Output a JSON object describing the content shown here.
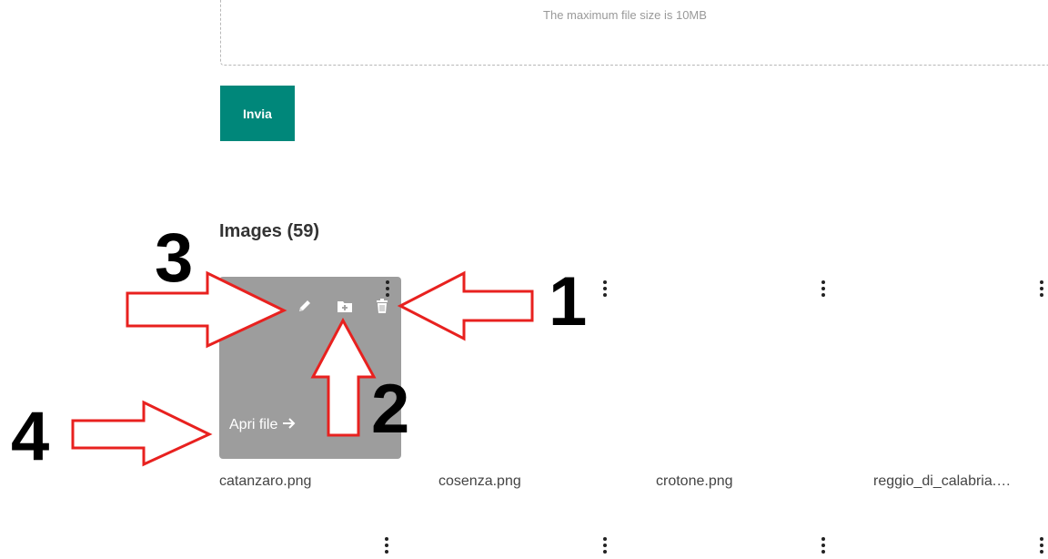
{
  "upload": {
    "max_size_note": "The maximum file size is 10MB",
    "submit_label": "Invia"
  },
  "gallery": {
    "title": "Images (59)",
    "open_label": "Apri file",
    "files": [
      "catanzaro.png",
      "cosenza.png",
      "crotone.png",
      "reggio_di_calabria.…"
    ]
  },
  "annotations": {
    "numbers": [
      "1",
      "2",
      "3",
      "4"
    ],
    "color": "#e8211f"
  },
  "colors": {
    "primary": "#00877a",
    "card_bg": "#9d9d9d"
  },
  "icons": [
    "pencil-icon",
    "folder-plus-icon",
    "trash-icon",
    "arrow-right-icon",
    "kebab-menu-icon"
  ]
}
